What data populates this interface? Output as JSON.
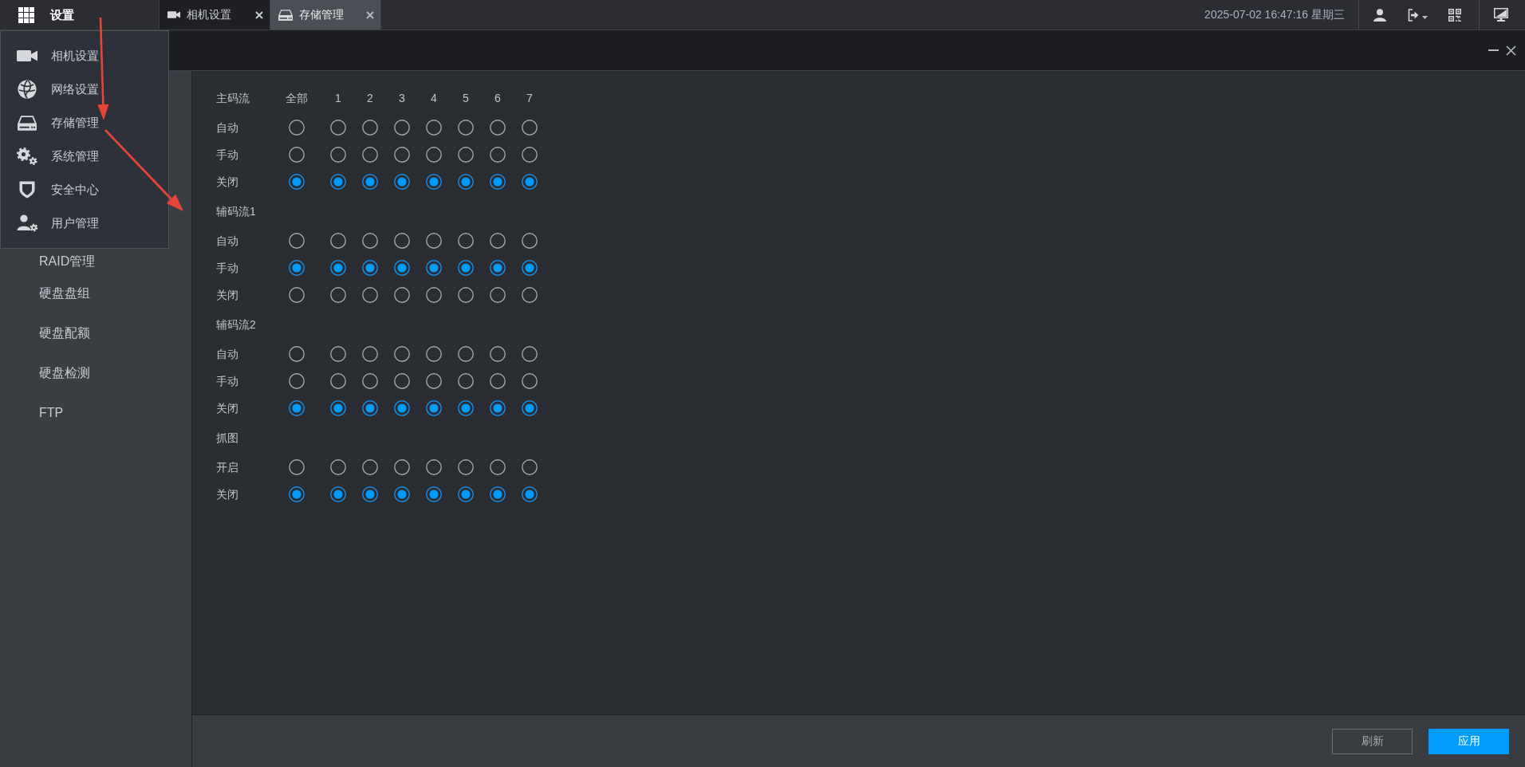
{
  "top_bar": {
    "title": "设置",
    "tabs": [
      {
        "label": "相机设置",
        "selected": false
      },
      {
        "label": "存储管理",
        "selected": true
      }
    ],
    "datetime": "2025-07-02 16:47:16 星期三"
  },
  "menu": {
    "items": [
      "相机设置",
      "网络设置",
      "存储管理",
      "系统管理",
      "安全中心",
      "用户管理"
    ]
  },
  "sidebar": {
    "items": [
      {
        "label": "RAID管理",
        "selected": false
      },
      {
        "label": "硬盘盘组",
        "selected": false
      },
      {
        "label": "硬盘配额",
        "selected": false
      },
      {
        "label": "硬盘检测",
        "selected": false
      },
      {
        "label": "FTP",
        "selected": false
      }
    ]
  },
  "grid": {
    "columns": [
      "全部",
      "1",
      "2",
      "3",
      "4",
      "5",
      "6",
      "7"
    ],
    "sections": [
      {
        "title": "主码流",
        "rows": [
          {
            "label": "自动",
            "checked": [
              false,
              false,
              false,
              false,
              false,
              false,
              false,
              false
            ]
          },
          {
            "label": "手动",
            "checked": [
              false,
              false,
              false,
              false,
              false,
              false,
              false,
              false
            ]
          },
          {
            "label": "关闭",
            "checked": [
              true,
              true,
              true,
              true,
              true,
              true,
              true,
              true
            ]
          }
        ]
      },
      {
        "title": "辅码流1",
        "rows": [
          {
            "label": "自动",
            "checked": [
              false,
              false,
              false,
              false,
              false,
              false,
              false,
              false
            ]
          },
          {
            "label": "手动",
            "checked": [
              true,
              true,
              true,
              true,
              true,
              true,
              true,
              true
            ]
          },
          {
            "label": "关闭",
            "checked": [
              false,
              false,
              false,
              false,
              false,
              false,
              false,
              false
            ]
          }
        ]
      },
      {
        "title": "辅码流2",
        "rows": [
          {
            "label": "自动",
            "checked": [
              false,
              false,
              false,
              false,
              false,
              false,
              false,
              false
            ]
          },
          {
            "label": "手动",
            "checked": [
              false,
              false,
              false,
              false,
              false,
              false,
              false,
              false
            ]
          },
          {
            "label": "关闭",
            "checked": [
              true,
              true,
              true,
              true,
              true,
              true,
              true,
              true
            ]
          }
        ]
      },
      {
        "title": "抓图",
        "rows": [
          {
            "label": "开启",
            "checked": [
              false,
              false,
              false,
              false,
              false,
              false,
              false,
              false
            ]
          },
          {
            "label": "关闭",
            "checked": [
              true,
              true,
              true,
              true,
              true,
              true,
              true,
              true
            ]
          }
        ]
      }
    ]
  },
  "footer": {
    "buttons": [
      {
        "label": "刷新",
        "kind": "secondary"
      },
      {
        "label": "应用",
        "kind": "primary"
      }
    ]
  },
  "annotations": [
    {
      "kind": "arrow"
    },
    {
      "kind": "arrow"
    }
  ]
}
